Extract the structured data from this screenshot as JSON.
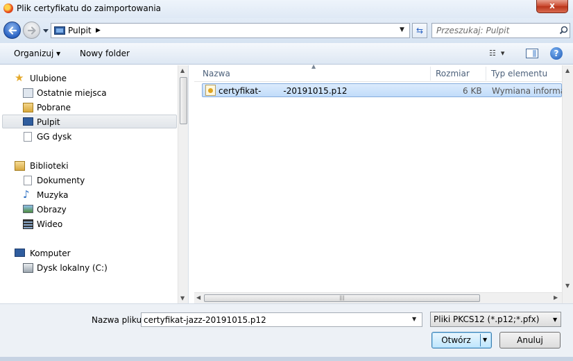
{
  "window": {
    "title": "Plik certyfikatu do zaimportowania",
    "close_label": "x"
  },
  "address_bar": {
    "location": "Pulpit",
    "search_placeholder": "Przeszukaj: Pulpit"
  },
  "toolbar": {
    "organize_label": "Organizuj ▾",
    "new_folder_label": "Nowy folder"
  },
  "sidebar": {
    "groups": [
      {
        "label": "Ulubione",
        "icon": "star-icon",
        "items": [
          {
            "label": "Ostatnie miejsca",
            "icon": "recent-places-icon"
          },
          {
            "label": "Pobrane",
            "icon": "downloads-folder-icon"
          },
          {
            "label": "Pulpit",
            "icon": "desktop-icon",
            "selected": true
          },
          {
            "label": "GG dysk",
            "icon": "document-icon"
          }
        ]
      },
      {
        "label": "Biblioteki",
        "icon": "libraries-icon",
        "items": [
          {
            "label": "Dokumenty",
            "icon": "documents-icon"
          },
          {
            "label": "Muzyka",
            "icon": "music-icon"
          },
          {
            "label": "Obrazy",
            "icon": "pictures-icon"
          },
          {
            "label": "Wideo",
            "icon": "video-icon"
          }
        ]
      },
      {
        "label": "Komputer",
        "icon": "computer-icon",
        "items": [
          {
            "label": "Dysk lokalny (C:)",
            "icon": "local-disk-icon"
          }
        ]
      }
    ]
  },
  "file_list": {
    "columns": [
      "Nazwa",
      "Rozmiar",
      "Typ elementu"
    ],
    "rows": [
      {
        "name_prefix": "certyfikat-",
        "name_suffix": "-20191015.p12",
        "size": "6 KB",
        "type": "Wymiana informa...",
        "selected": true
      }
    ]
  },
  "footer": {
    "filename_label": "Nazwa pliku:",
    "filename_value": "certyfikat-jazz-20191015.p12",
    "filetype_value": "Pliki PKCS12 (*.p12;*.pfx)",
    "open_label": "Otwórz",
    "cancel_label": "Anuluj"
  },
  "colors": {
    "selection": "#c1dcfa",
    "accent": "#2a63c4"
  }
}
